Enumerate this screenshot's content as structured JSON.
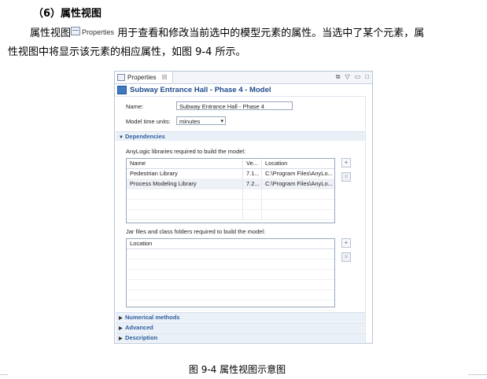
{
  "heading": "（6）属性视图",
  "paragraph": {
    "before": "属性视图",
    "inline_label": "Properties",
    "line1_after": "用于查看和修改当前选中的模型元素的属性。当选中了某个元素，属",
    "line2": "性视图中将显示该元素的相应属性，如图 9-4 所示。"
  },
  "panel": {
    "tab_label": "Properties",
    "tab_close": "☒",
    "title": "Subway Entrance Hall - Phase 4 - Model",
    "name_label": "Name:",
    "name_value": "Subway Entrance Hall - Phase 4",
    "time_units_label": "Model time units:",
    "time_units_value": "minutes",
    "dependencies_label": "Dependencies",
    "libs_label": "AnyLogic libraries required to build the model:",
    "libs_table": {
      "headers": [
        "Name",
        "Ve...",
        "Location"
      ],
      "rows": [
        [
          "Pedestrian Library",
          "7.1...",
          "C:\\Program Files\\AnyLo..."
        ],
        [
          "Process Modeling Library",
          "7.2...",
          "C:\\Program Files\\AnyLo..."
        ]
      ]
    },
    "jars_label": "Jar files and class folders required to build the model:",
    "jars_table": {
      "headers": [
        "Location"
      ]
    },
    "sections": [
      "Numerical methods",
      "Advanced",
      "Description"
    ]
  },
  "caption": "图 9-4  属性视图示意图",
  "colors": {
    "title": "#1f4a8a",
    "section": "#2f5f9e",
    "section_bg": "#eaf0f8"
  }
}
